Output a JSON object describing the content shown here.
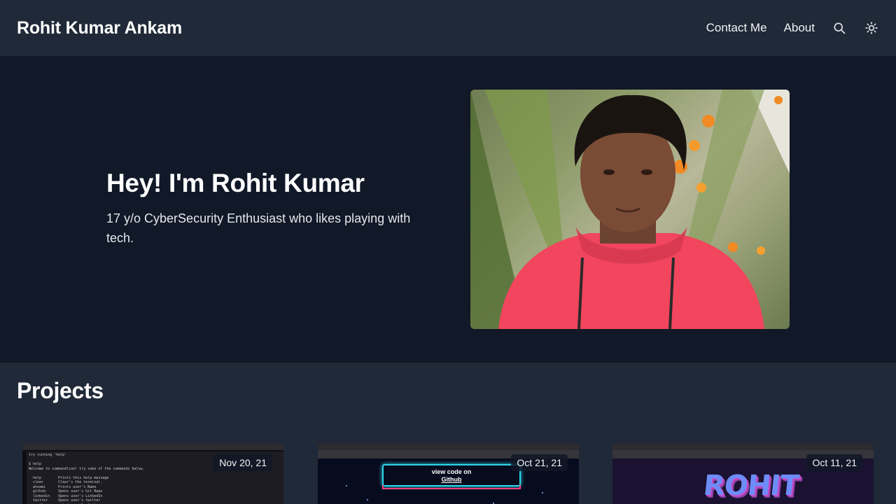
{
  "header": {
    "title": "Rohit Kumar Ankam",
    "nav": {
      "contact_label": "Contact Me",
      "about_label": "About"
    },
    "search_icon": "search-icon",
    "theme_icon": "sun-icon"
  },
  "hero": {
    "heading": "Hey! I'm Rohit Kumar",
    "subtitle": "17 y/o CyberSecurity Enthusiast who likes playing with tech."
  },
  "projects": {
    "title": "Projects",
    "cards": [
      {
        "date": "Nov 20, 21",
        "preview_text": "try running 'help'\n\n$ help\nWelcome to commandline! try some of the commands below.\n\n  help        Prints this help message\n  clear       Clear's the terminal.\n  whoami      Prints user's Name\n  github      Opens user's Git Repo\n  linkedin    Opens user's LinkedIn\n  twitter     Opens user's twitter\n  email       prints email of the user.\n  website     opens website of the user.\n  exit        close terminal."
      },
      {
        "date": "Oct 21, 21",
        "preview_line1": "view code on",
        "preview_line2": "Github"
      },
      {
        "date": "Oct 11, 21",
        "preview_word": "ROHIT"
      }
    ]
  },
  "colors": {
    "page_bg": "#111827",
    "header_bg": "#1f2937",
    "neon_cyan": "#2dd4e6",
    "neon_pink": "#ff3d7f"
  }
}
